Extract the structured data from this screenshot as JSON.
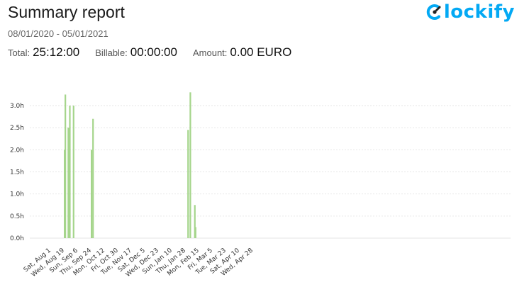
{
  "header": {
    "title": "Summary report",
    "date_range": "08/01/2020 - 05/01/2021",
    "logo_text": "lockify",
    "brand_color": "#03a9f4"
  },
  "totals": {
    "total_label": "Total:",
    "total_value": "25:12:00",
    "billable_label": "Billable:",
    "billable_value": "00:00:00",
    "amount_label": "Amount:",
    "amount_value": "0.00 EURO"
  },
  "chart_data": {
    "type": "bar",
    "bar_color": "#a5d58b",
    "grid": true,
    "ylim": [
      0,
      3.0
    ],
    "y_ticks": [
      "0.0h",
      "0.5h",
      "1.0h",
      "1.5h",
      "2.0h",
      "2.5h",
      "3.0h"
    ],
    "x_tick_labels": [
      "Sat, Aug 1",
      "Wed, Aug 19",
      "Sun, Sep 6",
      "Thu, Sep 24",
      "Mon, Oct 12",
      "Fri, Oct 30",
      "Tue, Nov 17",
      "Sat, Dec 5",
      "Wed, Dec 23",
      "Sun, Jan 10",
      "Thu, Jan 28",
      "Mon, Feb 15",
      "Fri, Mar 5",
      "Tue, Mar 23",
      "Sat, Apr 10",
      "Wed, Apr 28"
    ],
    "x_start": "2020-08-01",
    "tick_interval_days": 18,
    "series": [
      {
        "x": [
          "2020-08-19",
          "2020-08-20",
          "2020-08-24",
          "2020-08-26",
          "2020-08-31",
          "2020-09-24",
          "2020-09-26",
          "2021-01-31",
          "2021-02-03",
          "2021-02-09",
          "2021-02-10"
        ],
        "values": [
          2.0,
          3.25,
          2.5,
          3.0,
          3.0,
          2.0,
          2.7,
          2.45,
          3.3,
          0.75,
          0.25
        ]
      }
    ]
  }
}
